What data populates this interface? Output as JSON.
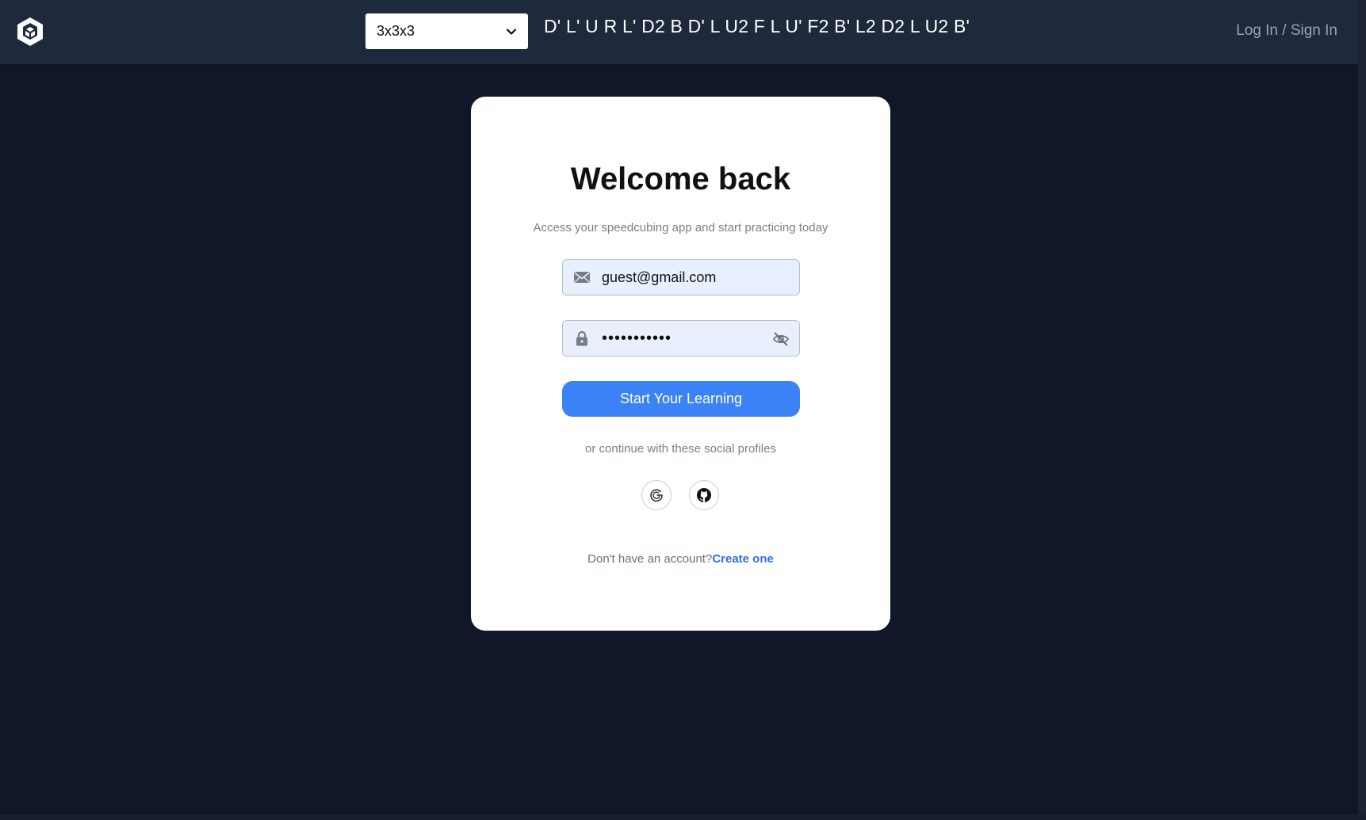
{
  "header": {
    "logo_icon": "cube-logo-icon",
    "puzzle_select": {
      "selected": "3x3x3",
      "icon": "chevron-down-icon"
    },
    "scramble": "D' L' U R L' D2 B D' L U2 F L U' F2 B' L2 D2 L U2 B'",
    "login_link": "Log In / Sign In"
  },
  "card": {
    "title": "Welcome back",
    "subtitle": "Access your speedcubing app and start practicing today",
    "email": {
      "value": "guest@gmail.com",
      "icon": "envelope-icon"
    },
    "password": {
      "value": "guest123456",
      "icon": "lock-icon",
      "toggle_icon": "eye-off-icon"
    },
    "submit_label": "Start Your Learning",
    "social_caption": "or continue with these social profiles",
    "social_buttons": [
      {
        "icon": "google-icon"
      },
      {
        "icon": "github-icon"
      }
    ],
    "signup_prompt": "Don't have an account?",
    "signup_link": "Create one"
  },
  "colors": {
    "page_bg": "#101729",
    "header_bg": "#1e293b",
    "accent": "#3b82f6",
    "link": "#2f6fde",
    "input_bg": "#e8f0fe"
  }
}
